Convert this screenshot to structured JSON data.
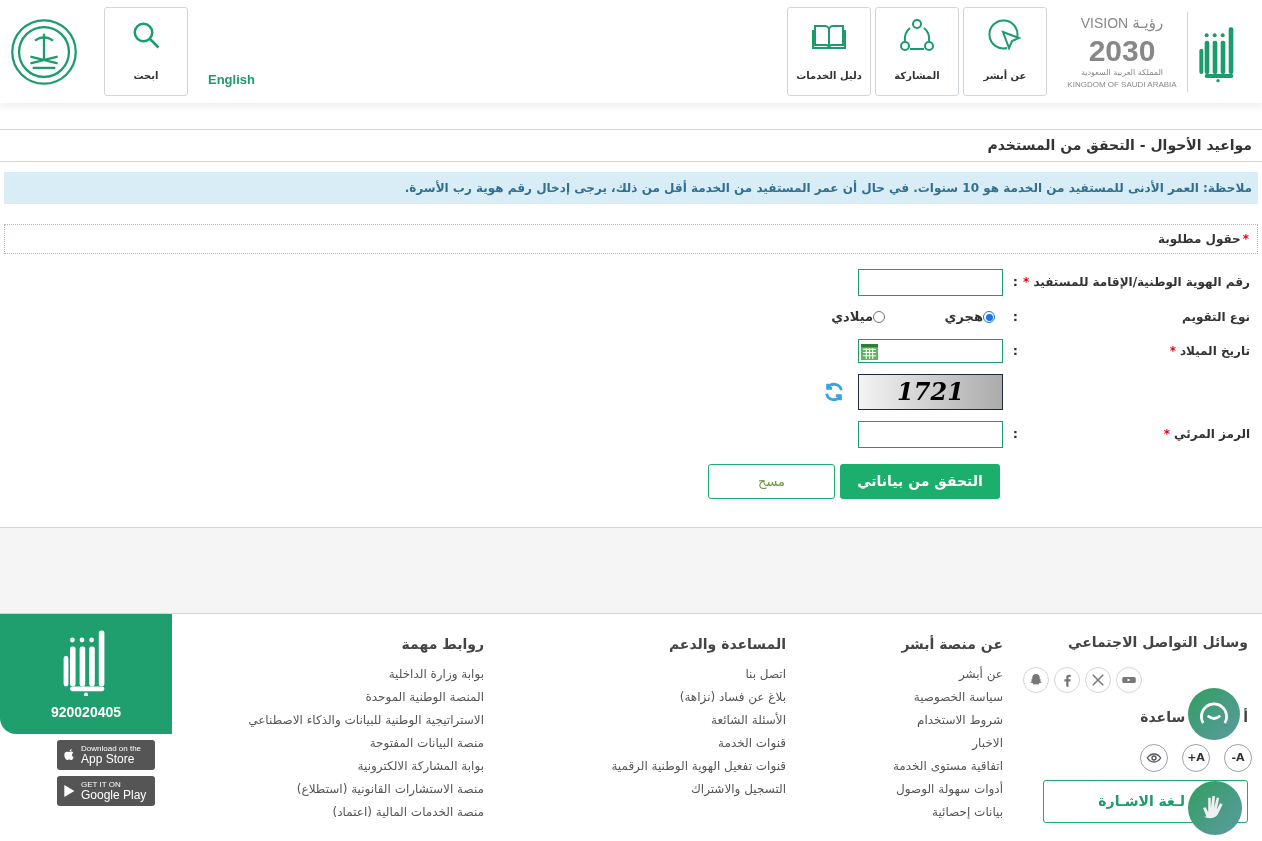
{
  "header": {
    "vision_logo": {
      "word_en": "VISION",
      "word_ar": "رؤيـة",
      "year": "2030",
      "country_ar": "المملكة العربية السعودية",
      "country_en": "KINGDOM OF SAUDI ARABIA"
    },
    "nav_tiles": [
      {
        "label": "عن أبشر",
        "kind": "cursor"
      },
      {
        "label": "المشاركة",
        "kind": "share"
      },
      {
        "label": "دليل الخدمات",
        "kind": "book"
      }
    ],
    "language_link": "English",
    "search_tile": {
      "label": "ابحث"
    }
  },
  "page_title": "مواعيد الأحوال - التحقق من المستخدم",
  "note": "ملاحظة: العمر الأدنى للمستفيد من الخدمة هو 10 سنوات. في حال أن عمر المستفيد من الخدمة أقل من ذلك، يرجى إدخال رقم هوية رب الأسرة.",
  "required_legend": {
    "mark": "*",
    "text": "حقول مطلوبة"
  },
  "form": {
    "rows": [
      {
        "kind": "text",
        "label": "رقم الهوية الوطنية/الإقامة للمستفيد",
        "required": true,
        "colon": ":"
      },
      {
        "kind": "radio",
        "label": "نوع التقويم",
        "required": false,
        "colon": ":",
        "options": [
          {
            "label": "هجري",
            "selected": true
          },
          {
            "label": "ميلادي",
            "selected": false
          }
        ]
      },
      {
        "kind": "date",
        "label": "تاريخ الميلاد",
        "required": true,
        "colon": ":"
      },
      {
        "kind": "captcha",
        "captcha_text": "1721"
      },
      {
        "kind": "text",
        "label": "الرمز المرئي",
        "required": true,
        "colon": ":"
      }
    ],
    "required_mark": "*",
    "buttons": [
      {
        "label": "التحقق من بياناتي",
        "kind": "primary"
      },
      {
        "label": "مسح",
        "kind": "secondary"
      }
    ]
  },
  "footer": {
    "social": {
      "title": "وسائل التواصل الاجتماعي"
    },
    "accessibility": {
      "title_parts": [
        "أ",
        "ساعدة"
      ],
      "buttons": [
        "-A",
        "+A"
      ],
      "sign_language_button": "لـغة الاشـارة"
    },
    "columns": [
      {
        "title": "عن منصة أبشر",
        "links": [
          "عن أبشر",
          "سياسة الخصوصية",
          "شروط الاستخدام",
          "الاخبار",
          "اتفاقية مستوى الخدمة",
          "أدوات سهولة الوصول",
          "بيانات إحصائية"
        ]
      },
      {
        "title": "المساعدة والدعم",
        "links": [
          "اتصل بنا",
          "بلاغ عن فساد (نزاهة)",
          "الأسئلة الشائعة",
          "قنوات الخدمة",
          "قنوات تفعيل الهوية الوطنية الرقمية",
          "التسجيل والاشتراك"
        ]
      },
      {
        "title": "روابط مهمة",
        "links": [
          "بوابة وزارة الداخلية",
          "المنصة الوطنية الموحدة",
          "الاستراتيجية الوطنية للبيانات والذكاء الاصطناعي",
          "منصة البيانات المفتوحة",
          "بوابة المشاركة الالكترونية",
          "منصة الاستشارات القانونية (استطلاع)",
          "منصة الخدمات المالية (اعتماد)"
        ]
      }
    ],
    "phone": "920020405",
    "app_badges": [
      {
        "small": "Download on the",
        "big": "App Store",
        "kind": "apple"
      },
      {
        "small": "GET IT ON",
        "big": "Google Play",
        "kind": "play"
      }
    ]
  }
}
